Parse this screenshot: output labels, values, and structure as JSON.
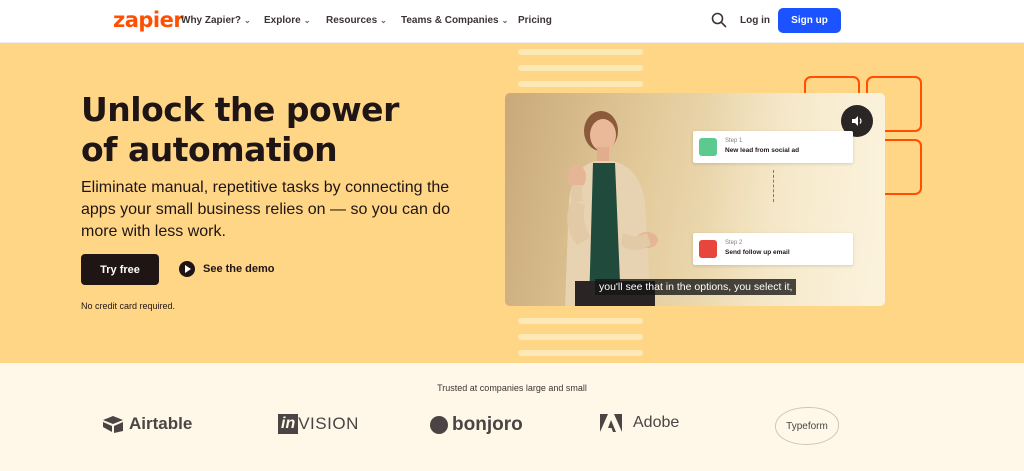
{
  "nav": {
    "logo": "zapier",
    "items": [
      {
        "label": "Why Zapier?",
        "has_dropdown": true
      },
      {
        "label": "Explore",
        "has_dropdown": true
      },
      {
        "label": "Resources",
        "has_dropdown": true
      },
      {
        "label": "Teams & Companies",
        "has_dropdown": true
      },
      {
        "label": "Pricing",
        "has_dropdown": false
      }
    ],
    "search_icon": "search-icon",
    "login": "Log in",
    "signup": "Sign up"
  },
  "hero": {
    "headline_line1": "Unlock the power",
    "headline_line2": "of automation",
    "subheading": "Eliminate manual, repetitive tasks by connecting the apps your small business relies on — so you can do more with less work.",
    "primary_cta": "Try free",
    "secondary_cta": "See the demo",
    "note": "No credit card required."
  },
  "video": {
    "step1": {
      "label": "Step 1",
      "text": "New lead from social ad"
    },
    "step2": {
      "label": "Step 2",
      "text": "Send follow up email"
    },
    "caption": "you'll see that in the options, you select it,",
    "mute_icon": "speaker-icon"
  },
  "trusted": {
    "title": "Trusted at companies large and small",
    "brands": [
      "Airtable",
      "invision",
      "bonjoro",
      "Adobe",
      "Typeform"
    ]
  },
  "colors": {
    "brand_orange": "#ff4f00",
    "hero_bg": "#ffd685",
    "signup_blue": "#1a53ff",
    "dark": "#201515",
    "trusted_bg": "#fff8e8"
  }
}
